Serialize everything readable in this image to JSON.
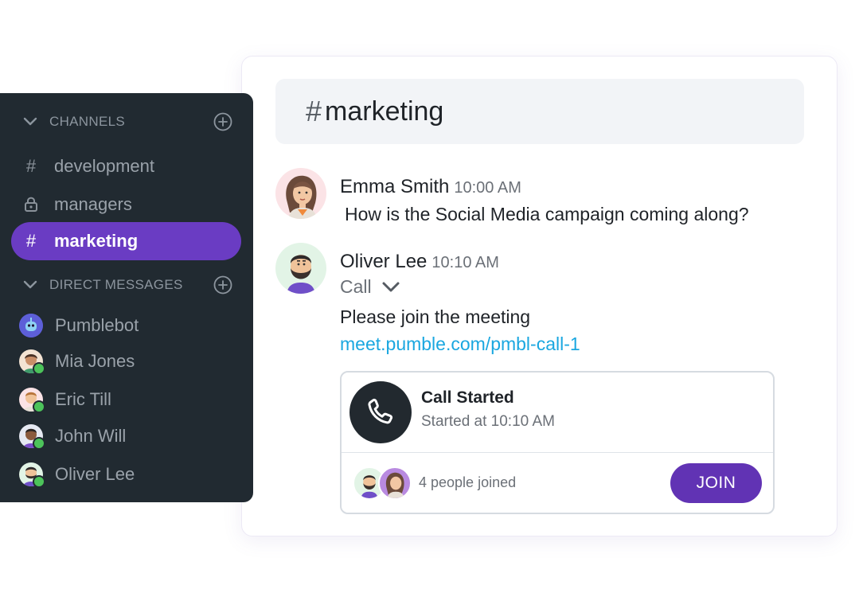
{
  "sidebar": {
    "channels_label": "CHANNELS",
    "channels": [
      {
        "icon": "hash-icon",
        "label": "development"
      },
      {
        "icon": "lock-icon",
        "label": "managers"
      },
      {
        "icon": "hash-icon",
        "label": "marketing",
        "active": true
      }
    ],
    "dm_label": "DIRECT MESSAGES",
    "direct_messages": [
      {
        "label": "Pumblebot",
        "status": "none"
      },
      {
        "label": "Mia Jones",
        "status": "online"
      },
      {
        "label": "Eric Till",
        "status": "online"
      },
      {
        "label": "John Will",
        "status": "online"
      },
      {
        "label": "Oliver Lee",
        "status": "online"
      }
    ]
  },
  "chat": {
    "hash": "#",
    "channel_title": "marketing",
    "messages": [
      {
        "author": "Emma Smith",
        "time": "10:00 AM",
        "text": "How is the Social Media campaign coming along?"
      },
      {
        "author": "Oliver Lee",
        "time": "10:10 AM",
        "call_toggle": "Call",
        "text": "Please join the meeting",
        "link": "meet.pumble.com/pmbl-call-1",
        "call_card": {
          "title": "Call Started",
          "subtitle": "Started at 10:10 AM",
          "joined": "4 people joined",
          "join_label": "JOIN"
        }
      }
    ]
  },
  "colors": {
    "accent": "#6a3cc3",
    "join_button": "#6133b4",
    "sidebar_bg": "#212a31",
    "link": "#1aa7e0",
    "online": "#4cc35a"
  }
}
